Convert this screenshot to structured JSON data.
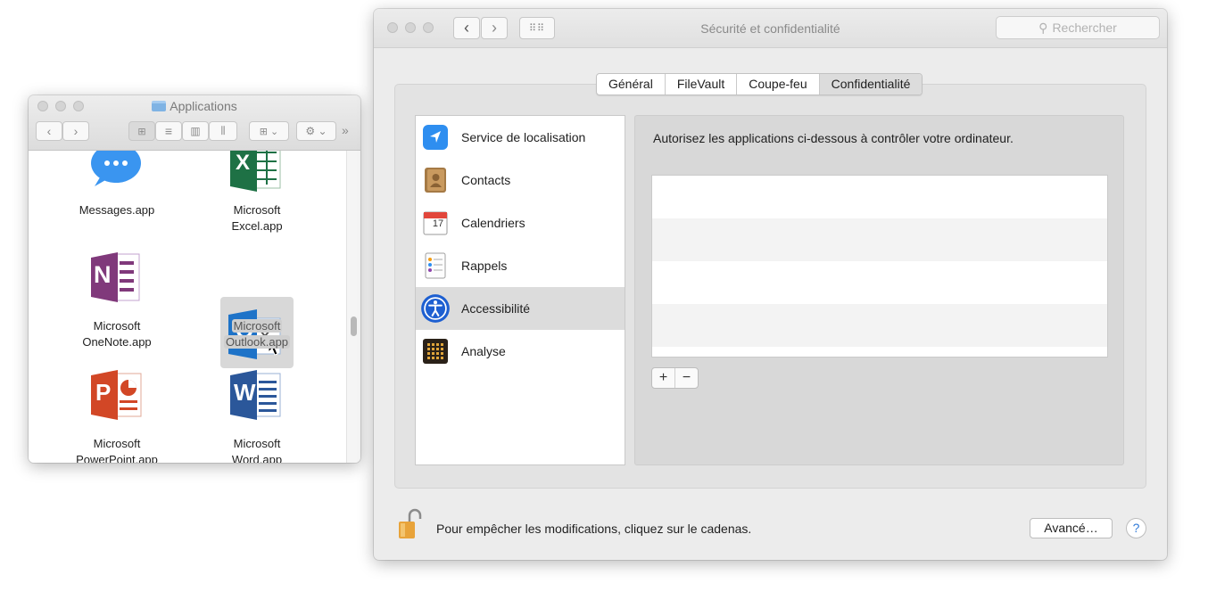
{
  "finder": {
    "title": "Applications",
    "apps": [
      {
        "label": "Messages.app"
      },
      {
        "label_line1": "Microsoft",
        "label_line2": "Excel.app"
      },
      {
        "label_line1": "Microsoft",
        "label_line2": "OneNote.app"
      },
      {
        "label_line1": "Microsoft",
        "label_line2": "Outlook.app"
      },
      {
        "label_line1": "Microsoft",
        "label_line2": "PowerPoint.app"
      },
      {
        "label_line1": "Microsoft",
        "label_line2": "Word.app"
      }
    ],
    "icon_letters": {
      "excel": "X",
      "onenote": "N",
      "outlook": "O",
      "powerpoint": "P",
      "word": "W"
    }
  },
  "prefs": {
    "title": "Sécurité et confidentialité",
    "search_placeholder": "Rechercher",
    "tabs": [
      {
        "label": "Général"
      },
      {
        "label": "FileVault"
      },
      {
        "label": "Coupe-feu"
      },
      {
        "label": "Confidentialité",
        "active": true
      }
    ],
    "categories": [
      {
        "label": "Service de localisation",
        "icon": "location-arrow-icon"
      },
      {
        "label": "Contacts",
        "icon": "contacts-book-icon"
      },
      {
        "label": "Calendriers",
        "icon": "calendar-icon"
      },
      {
        "label": "Rappels",
        "icon": "reminders-icon"
      },
      {
        "label": "Accessibilité",
        "icon": "accessibility-icon",
        "selected": true
      },
      {
        "label": "Analyse",
        "icon": "analytics-grid-icon"
      }
    ],
    "calendar_day": "17",
    "description": "Autorisez les applications ci-dessous à contrôler votre ordinateur.",
    "add_label": "+",
    "remove_label": "−",
    "lock_message": "Pour empêcher les modifications, cliquez sur le cadenas.",
    "advanced_label": "Avancé…",
    "help_label": "?"
  },
  "colors": {
    "selection_gray": "#dcdcdc",
    "help_blue": "#2f7ad8",
    "lock_orange": "#e8a33a"
  }
}
